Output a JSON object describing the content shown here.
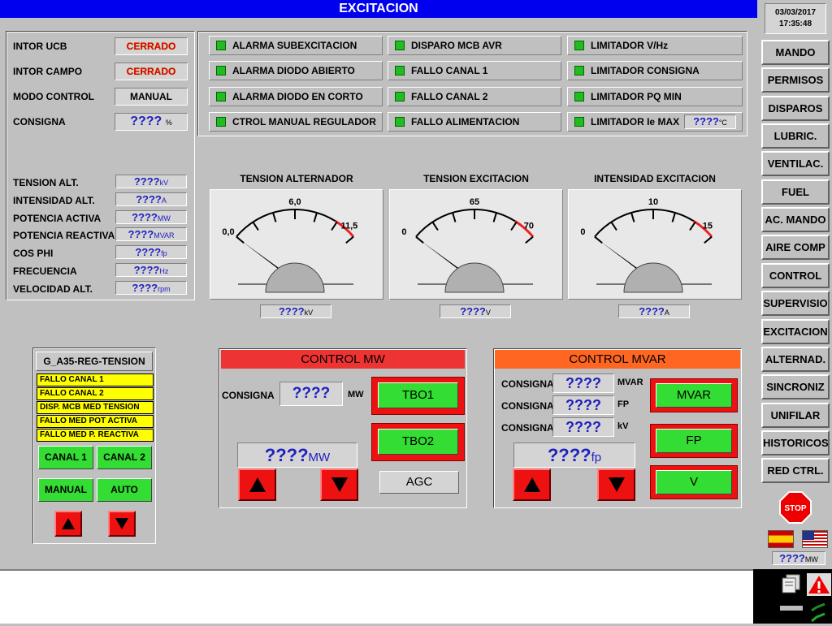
{
  "title": "EXCITACION",
  "datetime": {
    "date": "03/03/2017",
    "time": "17:35:48"
  },
  "status": {
    "intor_ucb": {
      "label": "INTOR UCB",
      "value": "CERRADO"
    },
    "intor_campo": {
      "label": "INTOR CAMPO",
      "value": "CERRADO"
    },
    "modo_control": {
      "label": "MODO CONTROL",
      "value": "MANUAL"
    },
    "consigna": {
      "label": "CONSIGNA",
      "value": "????",
      "unit": "%"
    }
  },
  "measurements": [
    {
      "label": "TENSION ALT.",
      "value": "????",
      "unit": "kV"
    },
    {
      "label": "INTENSIDAD ALT.",
      "value": "????",
      "unit": "A"
    },
    {
      "label": "POTENCIA ACTIVA",
      "value": "????",
      "unit": "MW"
    },
    {
      "label": "POTENCIA REACTIVA",
      "value": "????",
      "unit": "MVAR"
    },
    {
      "label": "COS PHI",
      "value": "????",
      "unit": "fp"
    },
    {
      "label": "FRECUENCIA",
      "value": "????",
      "unit": "Hz"
    },
    {
      "label": "VELOCIDAD ALT.",
      "value": "????",
      "unit": "rpm"
    }
  ],
  "alarms": {
    "col1": [
      "ALARMA SUBEXCITACION",
      "ALARMA DIODO ABIERTO",
      "ALARMA DIODO EN CORTO",
      "CTROL MANUAL REGULADOR"
    ],
    "col2": [
      "DISPARO MCB AVR",
      "FALLO CANAL 1",
      "FALLO CANAL 2",
      "FALLO ALIMENTACION"
    ],
    "col3": [
      "LIMITADOR V/Hz",
      "LIMITADOR CONSIGNA",
      "LIMITADOR PQ MIN",
      "LIMITADOR Ie MAX"
    ],
    "ie_max_value": "????",
    "ie_max_unit": "°C"
  },
  "gauges": [
    {
      "title": "TENSION ALTERNADOR",
      "ticks": [
        "0,0",
        "6,0",
        "11,5"
      ],
      "value": "????",
      "unit": "kV"
    },
    {
      "title": "TENSION EXCITACION",
      "ticks": [
        "0",
        "65",
        "70"
      ],
      "value": "????",
      "unit": "V"
    },
    {
      "title": "INTENSIDAD EXCITACION",
      "ticks": [
        "0",
        "10",
        "15"
      ],
      "value": "????",
      "unit": "A"
    }
  ],
  "reg_tension": {
    "title": "G_A35-REG-TENSION",
    "faults": [
      "FALLO CANAL 1",
      "FALLO CANAL 2",
      "DISP. MCB MED TENSION",
      "FALLO MED POT ACTIVA",
      "FALLO MED P. REACTIVA"
    ],
    "canal1": "CANAL 1",
    "canal2": "CANAL 2",
    "manual": "MANUAL",
    "auto": "AUTO"
  },
  "control_mw": {
    "title": "CONTROL MW",
    "consigna_label": "CONSIGNA",
    "consigna_value": "????",
    "consigna_unit": "MW",
    "display_value": "????",
    "display_unit": "MW",
    "tbo1": "TBO1",
    "tbo2": "TBO2",
    "agc": "AGC"
  },
  "control_mvar": {
    "title": "CONTROL MVAR",
    "rows": [
      {
        "label": "CONSIGNA",
        "value": "????",
        "unit": "MVAR"
      },
      {
        "label": "CONSIGNA",
        "value": "????",
        "unit": "FP"
      },
      {
        "label": "CONSIGNA",
        "value": "????",
        "unit": "kV"
      }
    ],
    "display_value": "????",
    "display_unit": "fp",
    "mvar": "MVAR",
    "fp": "FP",
    "v": "V"
  },
  "nav": [
    "MANDO",
    "PERMISOS",
    "DISPAROS",
    "LUBRIC.",
    "VENTILAC.",
    "FUEL",
    "AC. MANDO",
    "AIRE COMP",
    "CONTROL",
    "SUPERVISIO",
    "EXCITACION",
    "ALTERNAD.",
    "SINCRONIZ",
    "UNIFILAR",
    "HISTORICOS",
    "RED CTRL."
  ],
  "stop_label": "STOP",
  "side_value": {
    "value": "????",
    "unit": "MW"
  },
  "colors": {
    "title_bar": "#0000ee",
    "led_on": "#22bb22",
    "control_mw_header": "#ee3333",
    "control_mvar_header": "#ff6622",
    "fault_bg": "#ffff00"
  }
}
